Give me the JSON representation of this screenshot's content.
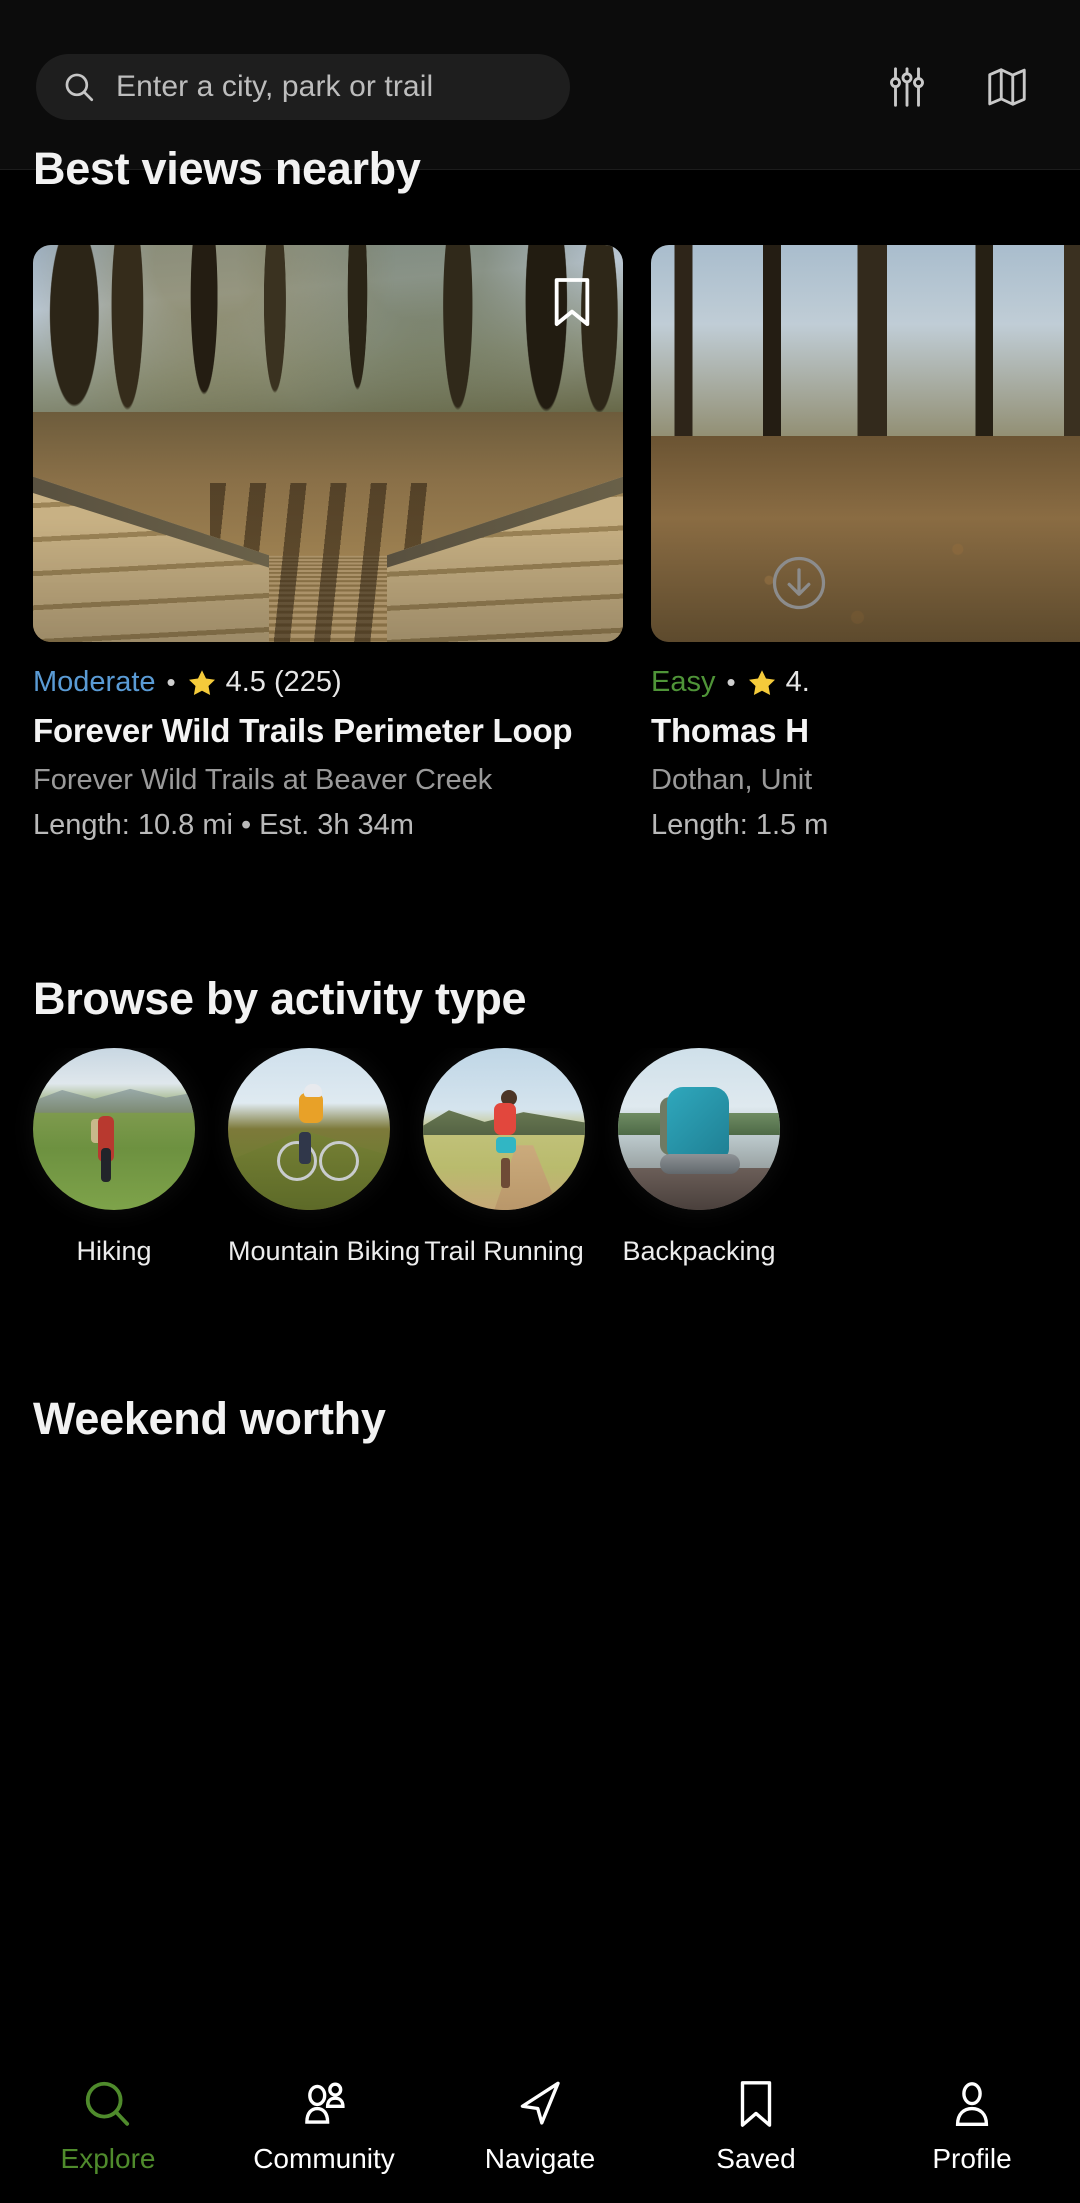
{
  "colors": {
    "background": "#000000",
    "header_bg": "#0c0c0c",
    "search_bg": "#1e1e1e",
    "accent_green": "#4f8b2c",
    "difficulty_moderate": "#5a9bd5",
    "difficulty_easy": "#4f9438",
    "star_yellow": "#f5cb3b",
    "text_primary": "#f4f4f4",
    "text_secondary": "#9a9a9a"
  },
  "search": {
    "placeholder": "Enter a city, park or trail",
    "value": "",
    "icon": "search-icon",
    "filter_icon": "sliders-filter-icon",
    "map_icon": "map-icon"
  },
  "sections": {
    "best_views": {
      "title": "Best views nearby"
    },
    "activity": {
      "title": "Browse by activity type"
    },
    "weekend": {
      "title": "Weekend worthy"
    }
  },
  "trail_cards": [
    {
      "difficulty": "Moderate",
      "difficulty_class": "diff-moderate",
      "separator": "•",
      "rating": "4.5",
      "review_count": "(225)",
      "title": "Forever Wild Trails Perimeter Loop",
      "location": "Forever Wild Trails at Beaver Creek",
      "stats": "Length: 10.8 mi • Est. 3h 34m",
      "bookmark_icon": "bookmark-icon",
      "photo": "boardwalk-forest-photo"
    },
    {
      "difficulty": "Easy",
      "difficulty_class": "diff-easy",
      "separator": "•",
      "rating": "4.",
      "review_count": "",
      "title": "Thomas H",
      "location": "Dothan, Unit",
      "stats": "Length: 1.5 m",
      "bookmark_icon": "bookmark-icon",
      "photo": "winter-woods-photo"
    }
  ],
  "download_button": {
    "icon": "download-circle-icon",
    "label": ""
  },
  "activities": [
    {
      "label": "Hiking",
      "image": "hiker-in-meadow"
    },
    {
      "label": "Mountain Biking",
      "image": "cyclist-on-ridge"
    },
    {
      "label": "Trail Running",
      "image": "runner-on-trail"
    },
    {
      "label": "Backpacking",
      "image": "backpack-by-lake"
    }
  ],
  "bottom_nav": [
    {
      "label": "Explore",
      "icon": "search-icon",
      "active": true
    },
    {
      "label": "Community",
      "icon": "people-icon",
      "active": false
    },
    {
      "label": "Navigate",
      "icon": "navigation-arrow-icon",
      "active": false
    },
    {
      "label": "Saved",
      "icon": "bookmark-icon",
      "active": false
    },
    {
      "label": "Profile",
      "icon": "person-icon",
      "active": false
    }
  ]
}
